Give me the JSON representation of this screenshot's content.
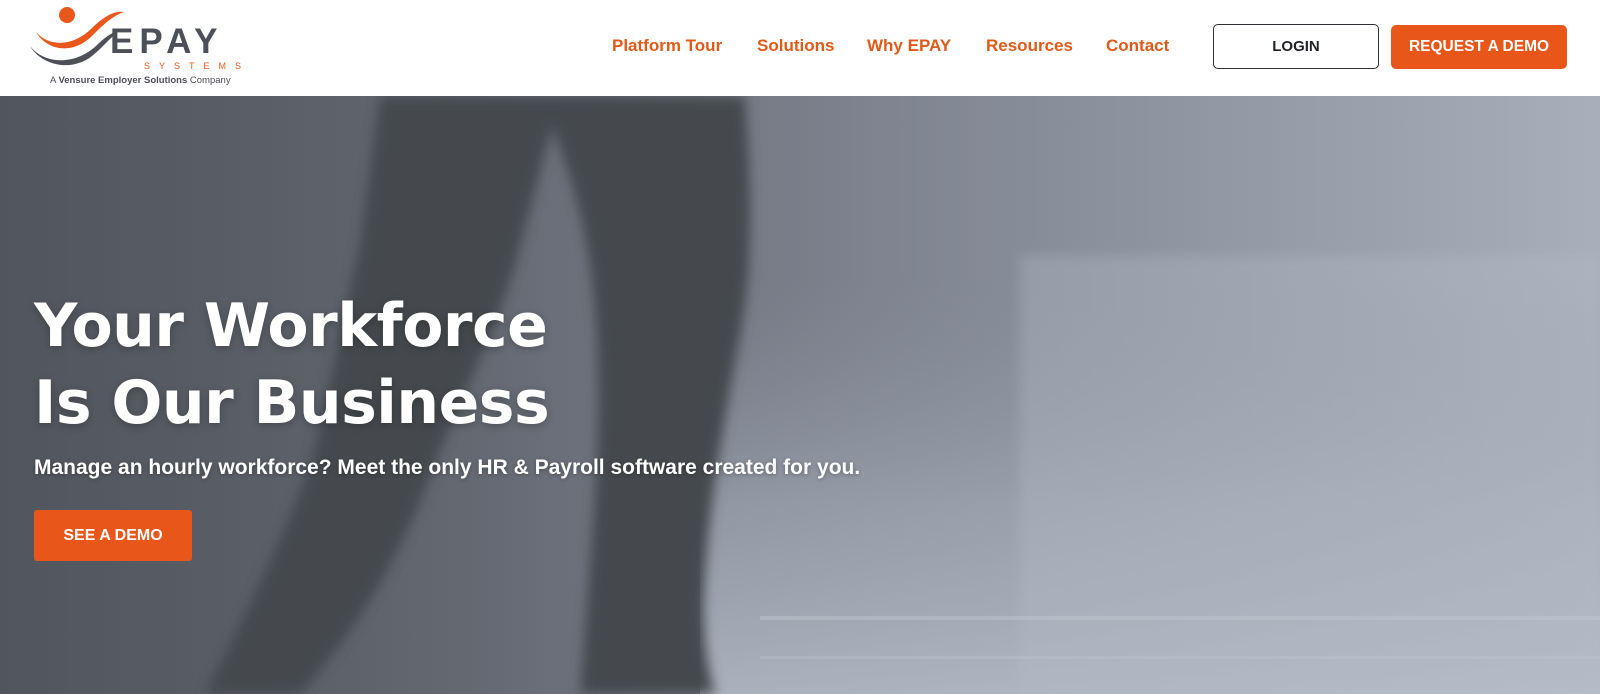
{
  "logo": {
    "wordmark": "EPAY",
    "subtitle": "SYSTEMS",
    "tagline_prefix": "A ",
    "tagline_brand": "Vensure Employer Solutions",
    "tagline_suffix": " Company"
  },
  "nav": {
    "items": [
      {
        "label": "Platform Tour"
      },
      {
        "label": "Solutions"
      },
      {
        "label": "Why EPAY"
      },
      {
        "label": "Resources"
      },
      {
        "label": "Contact"
      }
    ]
  },
  "header_actions": {
    "login_label": "LOGIN",
    "request_demo_label": "REQUEST A DEMO"
  },
  "hero": {
    "title_line1": "Your Workforce",
    "title_line2": "Is Our Business",
    "subtitle": "Manage an hourly workforce? Meet the only HR & Payroll software created for you.",
    "cta_label": "SEE A DEMO"
  },
  "colors": {
    "brand_orange": "#e8561a",
    "brand_gray": "#4d5058",
    "nav_text": "#e05a18"
  }
}
